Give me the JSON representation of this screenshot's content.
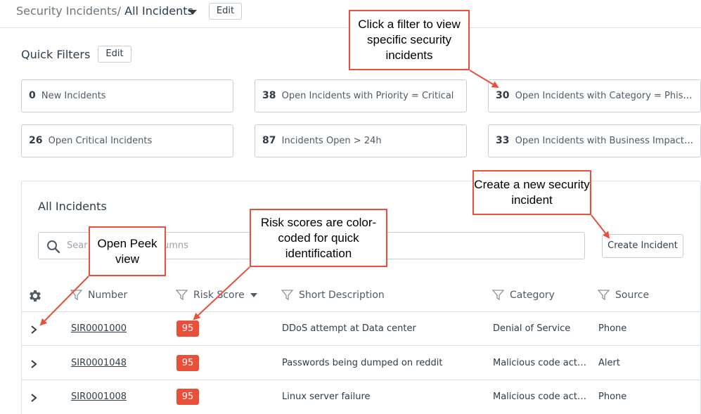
{
  "header": {
    "breadcrumb_parent": "Security Incidents/",
    "breadcrumb_current": "All Incidents",
    "edit_label": "Edit"
  },
  "quick_filters": {
    "title": "Quick Filters",
    "edit_label": "Edit",
    "cards": [
      {
        "count": "0",
        "label": "New Incidents"
      },
      {
        "count": "38",
        "label": "Open Incidents with Priority = Critical"
      },
      {
        "count": "30",
        "label": "Open Incidents with Category = Phish…"
      },
      {
        "count": "26",
        "label": "Open Critical Incidents"
      },
      {
        "count": "87",
        "label": "Incidents Open > 24h"
      },
      {
        "count": "33",
        "label": "Open Incidents with Business Impact …"
      }
    ]
  },
  "list": {
    "title": "All Incidents",
    "search_placeholder": "Sear",
    "search_placeholder_tail": "umns",
    "create_label": "Create Incident",
    "columns": [
      "Number",
      "Risk Score",
      "Short Description",
      "Category",
      "Source"
    ],
    "rows": [
      {
        "number": "SIR0001000",
        "risk": "95",
        "description": "DDoS attempt at Data center",
        "category": "Denial of Service",
        "source": "Phone"
      },
      {
        "number": "SIR0001048",
        "risk": "95",
        "description": "Passwords being dumped on reddit",
        "category": "Malicious code act…",
        "source": "Alert"
      },
      {
        "number": "SIR0001008",
        "risk": "95",
        "description": "Linux server failure",
        "category": "Malicious code act…",
        "source": "Phone"
      }
    ]
  },
  "callouts": {
    "filter": "Click a filter to view specific security incidents",
    "create": "Create a new security incident",
    "risk": "Risk scores are color-coded for quick identification",
    "peek": "Open Peek view"
  },
  "colors": {
    "accent": "#e8503a",
    "badge": "#e8503a",
    "border": "#c8ced3"
  }
}
